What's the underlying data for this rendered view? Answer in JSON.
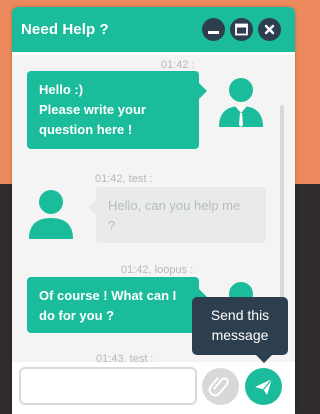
{
  "header": {
    "title": "Need Help ?",
    "controls": [
      {
        "name": "minimize",
        "icon": "minus-icon"
      },
      {
        "name": "maximize",
        "icon": "window-icon"
      },
      {
        "name": "close",
        "icon": "close-icon"
      }
    ]
  },
  "messages": [
    {
      "timestamp": "01:42 :",
      "text_lines": [
        "Hello :)",
        "Please write your",
        "question here !"
      ],
      "side": "right",
      "style": "green"
    },
    {
      "timestamp": "01:42, test :",
      "text_lines": [
        "Hello, can you help me",
        "?"
      ],
      "side": "left",
      "style": "grey"
    },
    {
      "timestamp": "01:42, loopus :",
      "text_lines": [
        "Of course ! What can I",
        "do for you ?"
      ],
      "side": "right",
      "style": "green"
    },
    {
      "timestamp": "01:43, test :"
    }
  ],
  "composer": {
    "input_value": "",
    "input_placeholder": "",
    "attach_icon": "paperclip-icon",
    "send_icon": "send-icon"
  },
  "tooltip": {
    "line1": "Send this",
    "line2": "message"
  },
  "colors": {
    "accent": "#1abc9c",
    "dark": "#2d3e4f",
    "background_top": "#ec8a5e",
    "background_bottom": "#2f2c2b"
  }
}
